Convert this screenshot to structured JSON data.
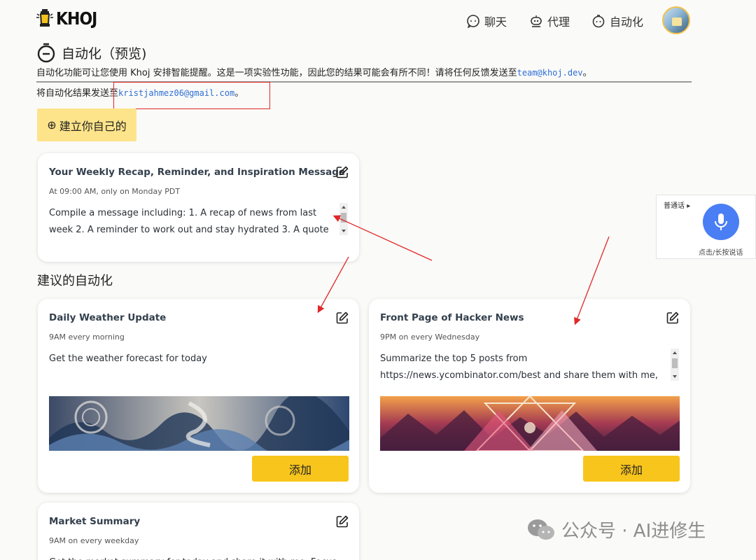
{
  "header": {
    "logo_text": "KHOJ",
    "nav": [
      {
        "label": "聊天",
        "icon": "chat-icon"
      },
      {
        "label": "代理",
        "icon": "agent-icon"
      },
      {
        "label": "自动化",
        "icon": "automation-icon"
      }
    ],
    "avatar": "user-avatar"
  },
  "page": {
    "title": "自动化（预览)",
    "intro_text": "自动化功能可让您使用 Khoj 安排智能提醒。这是一项实验性功能，因此您的结果可能会有所不同！请将任何反馈发送至",
    "intro_link": "team@khoj.dev",
    "intro_end": "。",
    "email_prefix": "将自动化结果发送至",
    "email": "kristjahmez06@gmail.com",
    "email_end": "。",
    "create_button": "建立你自己的"
  },
  "my_automations": [
    {
      "title": "Your Weekly Recap, Reminder, and Inspiration Message",
      "schedule": "At 09:00 AM, only on Monday PDT",
      "description": "Compile a message including: 1. A recap of news from last week 2. A reminder to work out and stay hydrated 3. A quote"
    }
  ],
  "suggested_heading": "建议的自动化",
  "suggested": [
    {
      "title": "Daily Weather Update",
      "schedule": "9AM every morning",
      "description": "Get the weather forecast for today",
      "add_label": "添加",
      "image": "abstract-wave-art"
    },
    {
      "title": "Front Page of Hacker News",
      "schedule": "9PM on every Wednesday",
      "description": "Summarize the top 5 posts from https://news.ycombinator.com/best and share them with me,",
      "add_label": "添加",
      "image": "geometric-mountain-art"
    },
    {
      "title": "Market Summary",
      "schedule": "9AM on every weekday",
      "description": "Get the market summary for today and share it with me. Focus"
    }
  ],
  "voice_widget": {
    "language": "普通话",
    "hint": "点击/长按说话"
  },
  "watermark": "公众号 · AI进修生",
  "colors": {
    "accent_yellow": "#f8c51c",
    "light_yellow": "#fde48a",
    "link_blue": "#2f6fd6",
    "annotation_red": "#e02828",
    "mic_blue": "#4a7ef5"
  }
}
